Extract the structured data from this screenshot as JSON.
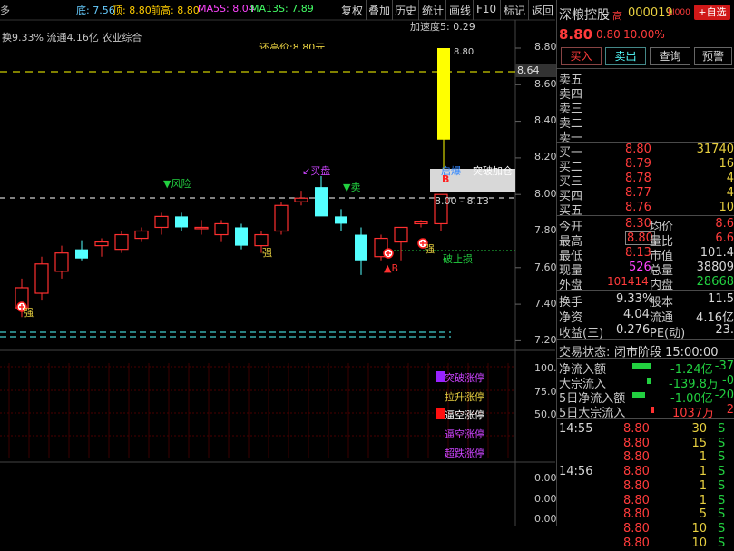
{
  "topbar": {
    "icon_label": "多",
    "ma": {
      "low": "底: 7.56",
      "top": "顶: 8.80",
      "prev_high": "前高: 8.80",
      "ma5s": "MA5S: 8.04",
      "ma13s": "MA13S: 7.89"
    },
    "buttons": [
      "复权",
      "叠加",
      "历史",
      "统计",
      "画线",
      "F10",
      "标记",
      "返回"
    ]
  },
  "info_line": "换9.33% 流通4.16亿 农业综合",
  "accel_label": "加速度5: 0.29",
  "top_price_note": "8.80",
  "partial_label": "还高价:8.80元",
  "price_axis": [
    "8.80",
    "8.60",
    "8.40",
    "8.20",
    "8.00",
    "7.80",
    "7.60",
    "7.40",
    "7.20"
  ],
  "price_tag": "8.64",
  "lower_axis": [
    "100.0",
    "75.0",
    "50.0"
  ],
  "bottom_axis": [
    "0.00",
    "0.00",
    "0.00"
  ],
  "signals": {
    "risk": "▼风险",
    "buy_out": "↙买盘",
    "sell": "▼卖",
    "strong1": "强",
    "strong2": "强",
    "strong3": "强",
    "breakout_label": "突破加仓",
    "start_label": "启爆",
    "range_label": "8.00 - 8.13",
    "b_marker": "B",
    "b_marker2": "▲B",
    "stop_loss": "破止损"
  },
  "legend": [
    "突破涨停",
    "拉升涨停",
    "逼空涨停",
    "逼空涨停",
    "超跌涨停"
  ],
  "stock": {
    "name": "深粮控股",
    "tag": "高",
    "code": "000019",
    "market": "LI000",
    "add_btn": "+自选",
    "price": "8.80",
    "change": "0.80",
    "pct": "10.00%"
  },
  "trade_buttons": [
    "买入",
    "卖出",
    "查询",
    "预警"
  ],
  "sell_orders": [
    "卖五",
    "卖四",
    "卖三",
    "卖二",
    "卖一"
  ],
  "buy_orders": [
    {
      "label": "买一",
      "price": "8.80",
      "vol": "31740"
    },
    {
      "label": "买二",
      "price": "8.79",
      "vol": "16"
    },
    {
      "label": "买三",
      "price": "8.78",
      "vol": "4"
    },
    {
      "label": "买四",
      "price": "8.77",
      "vol": "4"
    },
    {
      "label": "买五",
      "price": "8.76",
      "vol": "10"
    }
  ],
  "quote": [
    {
      "l1": "今开",
      "v1": "8.30",
      "l2": "均价",
      "v2": "8.6"
    },
    {
      "l1": "最高",
      "v1": "8.80",
      "l2": "量比",
      "v2": "6.6"
    },
    {
      "l1": "最低",
      "v1": "8.13",
      "l2": "市值",
      "v2": "101.4"
    },
    {
      "l1": "现量",
      "v1": "526",
      "l2": "总量",
      "v2": "38809"
    },
    {
      "l1": "外盘",
      "v1": "101414",
      "l2": "内盘",
      "v2": "28668"
    }
  ],
  "finance": [
    {
      "l1": "换手",
      "v1": "9.33%",
      "l2": "股本",
      "v2": "11.5"
    },
    {
      "l1": "净资",
      "v1": "4.04",
      "l2": "流通",
      "v2": "4.16亿"
    },
    {
      "l1": "收益(三)",
      "v1": "0.276",
      "l2": "PE(动)",
      "v2": "23."
    }
  ],
  "status": {
    "label": "交易状态:",
    "value": "闭市阶段 15:00:00"
  },
  "flows": [
    {
      "label": "净流入额",
      "value": "-1.24亿",
      "pct": "-37"
    },
    {
      "label": "大宗流入",
      "value": "-139.8万",
      "pct": "-0"
    },
    {
      "label": "5日净流入额",
      "value": "-1.00亿",
      "pct": "-20"
    },
    {
      "label": "5日大宗流入",
      "value": "1037万",
      "pct": "2"
    }
  ],
  "ticks": [
    {
      "time": "14:55",
      "price": "8.80",
      "vol": "30",
      "dir": "S"
    },
    {
      "time": "",
      "price": "8.80",
      "vol": "15",
      "dir": "S"
    },
    {
      "time": "",
      "price": "8.80",
      "vol": "1",
      "dir": "S"
    },
    {
      "time": "14:56",
      "price": "8.80",
      "vol": "1",
      "dir": "S"
    },
    {
      "time": "",
      "price": "8.80",
      "vol": "1",
      "dir": "S"
    },
    {
      "time": "",
      "price": "8.80",
      "vol": "1",
      "dir": "S"
    },
    {
      "time": "",
      "price": "8.80",
      "vol": "5",
      "dir": "S"
    },
    {
      "time": "",
      "price": "8.80",
      "vol": "10",
      "dir": "S"
    },
    {
      "time": "",
      "price": "8.80",
      "vol": "10",
      "dir": "S"
    }
  ],
  "colors": {
    "up": "#ff3030",
    "down": "#54ffff",
    "yellow": "#ffff00",
    "purple": "#cc44ff",
    "green": "#22d040"
  },
  "chart_data": {
    "type": "candlestick",
    "ohlc": [
      [
        7.38,
        7.54,
        7.33,
        7.49
      ],
      [
        7.46,
        7.66,
        7.42,
        7.62
      ],
      [
        7.58,
        7.72,
        7.54,
        7.68
      ],
      [
        7.7,
        7.75,
        7.64,
        7.65
      ],
      [
        7.72,
        7.76,
        7.66,
        7.74
      ],
      [
        7.7,
        7.8,
        7.68,
        7.78
      ],
      [
        7.76,
        7.82,
        7.74,
        7.8
      ],
      [
        7.82,
        7.9,
        7.78,
        7.88
      ],
      [
        7.88,
        7.9,
        7.8,
        7.82
      ],
      [
        7.82,
        7.86,
        7.78,
        7.82
      ],
      [
        7.78,
        7.86,
        7.74,
        7.84
      ],
      [
        7.82,
        7.84,
        7.7,
        7.72
      ],
      [
        7.72,
        7.8,
        7.68,
        7.78
      ],
      [
        7.8,
        7.96,
        7.78,
        7.94
      ],
      [
        7.96,
        8.02,
        7.94,
        7.98
      ],
      [
        8.04,
        8.1,
        7.9,
        7.88
      ],
      [
        7.88,
        7.92,
        7.8,
        7.84
      ],
      [
        7.78,
        7.82,
        7.56,
        7.64
      ],
      [
        7.66,
        7.78,
        7.64,
        7.76
      ],
      [
        7.74,
        7.82,
        7.64,
        7.82
      ],
      [
        7.84,
        7.86,
        7.82,
        7.85
      ],
      [
        7.84,
        8.0,
        7.8,
        8.0
      ],
      [
        8.3,
        8.8,
        8.13,
        8.8
      ]
    ]
  }
}
